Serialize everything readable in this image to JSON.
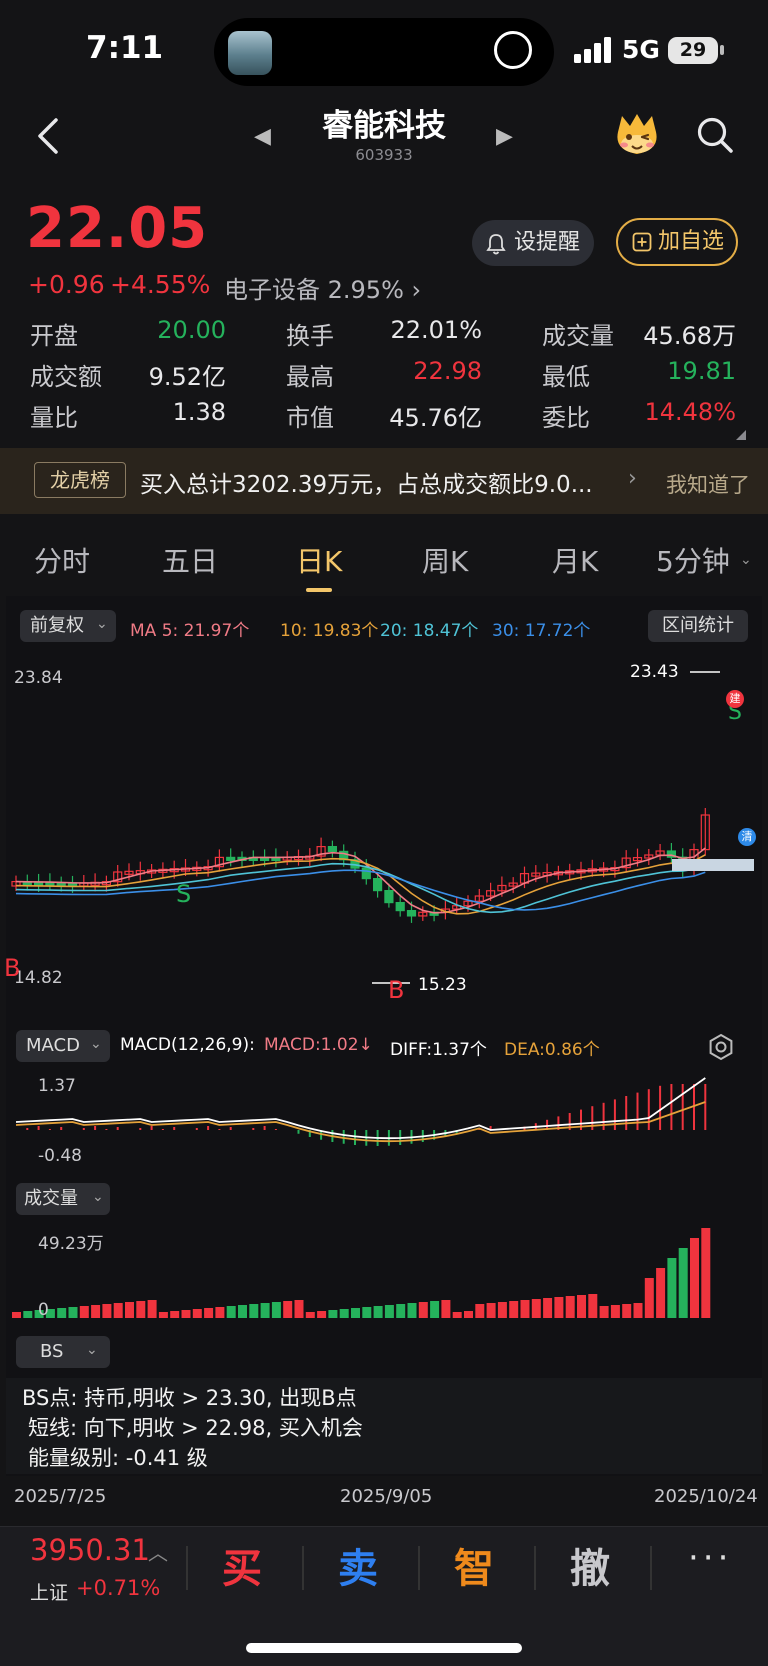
{
  "status_bar": {
    "time": "7:11",
    "network": "5G",
    "battery": "29"
  },
  "header": {
    "title": "睿能科技",
    "code": "603933"
  },
  "quote": {
    "price": "22.05",
    "change": "+0.96",
    "change_pct": "+4.55%",
    "sector": "电子设备 2.95% ›",
    "remind_label": "设提醒",
    "watch_label": "加自选",
    "stats": [
      {
        "label": "开盘",
        "value": "20.00",
        "color": "#25b25c"
      },
      {
        "label": "换手",
        "value": "22.01%",
        "color": "#e8e8ea"
      },
      {
        "label": "成交量",
        "value": "45.68万",
        "color": "#e8e8ea"
      },
      {
        "label": "成交额",
        "value": "9.52亿",
        "color": "#e8e8ea"
      },
      {
        "label": "最高",
        "value": "22.98",
        "color": "#f0343e"
      },
      {
        "label": "最低",
        "value": "19.81",
        "color": "#25b25c"
      },
      {
        "label": "量比",
        "value": "1.38",
        "color": "#e8e8ea"
      },
      {
        "label": "市值",
        "value": "45.76亿",
        "color": "#e8e8ea"
      },
      {
        "label": "委比",
        "value": "14.48%",
        "color": "#f0343e"
      }
    ]
  },
  "banner": {
    "tag": "龙虎榜",
    "text": "买入总计3202.39万元，占总成交额比9.0...",
    "dismiss": "我知道了"
  },
  "tabs": [
    "分时",
    "五日",
    "日K",
    "周K",
    "月K",
    "5分钟"
  ],
  "active_tab": "日K",
  "kline": {
    "adjust_label": "前复权",
    "range_label": "区间统计",
    "ma": {
      "ma5": "MA 5: 21.97个",
      "ma10": "10: 19.83个",
      "ma20": "20: 18.47个",
      "ma30": "30: 17.72个"
    },
    "axis_top": "23.84",
    "axis_bottom": "14.82",
    "high_mark": "23.43",
    "low_mark": "15.23",
    "marks": {
      "buy": "B",
      "sell": "S",
      "build": "建",
      "clear": "清"
    }
  },
  "macd": {
    "tag": "MACD",
    "params": "MACD(12,26,9):",
    "macd": "MACD:1.02↓",
    "diff": "DIFF:1.37个",
    "dea": "DEA:0.86个",
    "axis_top": "1.37",
    "axis_bottom": "-0.48"
  },
  "volume": {
    "tag": "成交量",
    "axis_top": "49.23万",
    "axis_bottom": "0"
  },
  "bs": {
    "tag": "BS",
    "lines": [
      "BS点: 持币,明收 > 23.30, 出现B点",
      "短线: 向下,明收 > 22.98, 买入机会",
      "能量级别: -0.41 级"
    ]
  },
  "dates": [
    "2025/7/25",
    "2025/9/05",
    "2025/10/24"
  ],
  "bottom_bar": {
    "index_value": "3950.31",
    "index_name": "上证",
    "index_pct": "+0.71%",
    "buy": "买",
    "sell": "卖",
    "smart": "智",
    "cancel": "撤",
    "more": "···"
  },
  "colors": {
    "up": "#f0343e",
    "down": "#25b25c",
    "accent": "#f3c66a",
    "ma5": "#f07b86",
    "ma10": "#e5a23a",
    "ma20": "#4fc3d6",
    "ma30": "#3b8fe8"
  }
}
